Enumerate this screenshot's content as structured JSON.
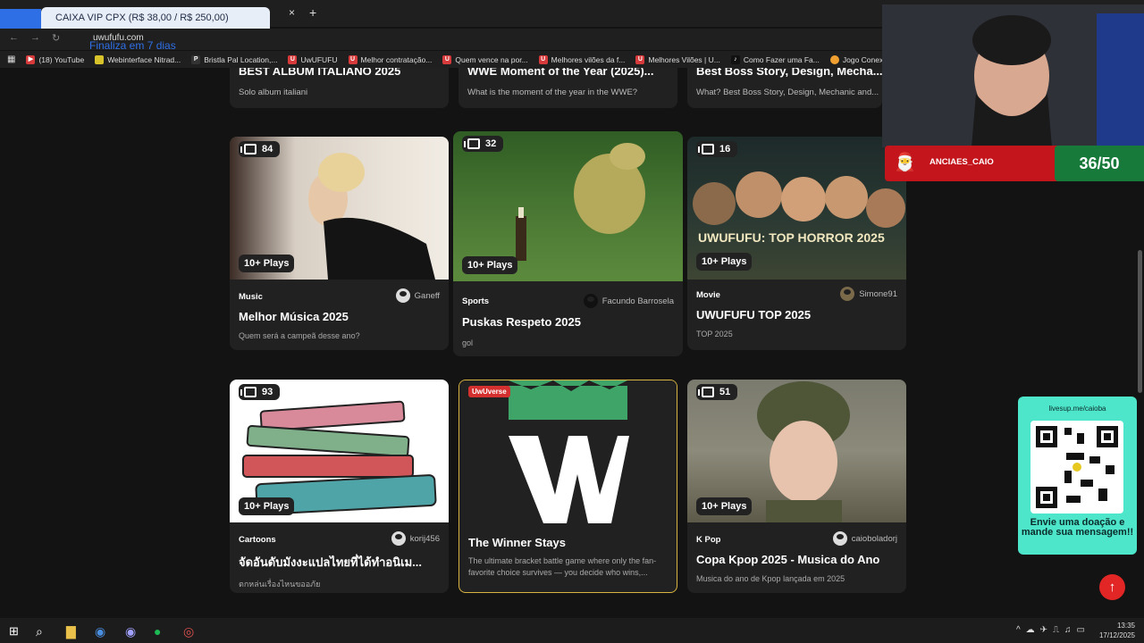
{
  "browser": {
    "tab_title": "CAIXA VIP CPX (R$ 38,00 / R$ 250,00)",
    "tab_close": "×",
    "new_tab": "+",
    "url": "uwufufu.com",
    "overlay_text": "Finaliza em 7 dias",
    "bookmarks": [
      {
        "label": "(18) YouTube"
      },
      {
        "label": "Webinterface Nitrad..."
      },
      {
        "label": "Bristla Pal Location,..."
      },
      {
        "label": "UwUFUFU"
      },
      {
        "label": "Melhor contratação..."
      },
      {
        "label": "Quem vence na por..."
      },
      {
        "label": "Melhores vilões da f..."
      },
      {
        "label": "Melhores Vilões | U..."
      },
      {
        "label": "Como Fazer uma Fa..."
      },
      {
        "label": "Jogo Conexões Esp..."
      }
    ]
  },
  "top_cards": [
    {
      "title": "BEST ALBUM ITALIANO 2025",
      "desc": "Solo album italiani"
    },
    {
      "title": "WWE Moment of the Year (2025)...",
      "desc": "What is the moment of the year in the WWE?"
    },
    {
      "title": "Best Boss Story, Design, Mecha...",
      "desc": "What? Best Boss Story, Design, Mechanic and..."
    }
  ],
  "cards": [
    {
      "count": "84",
      "plays": "10+ Plays",
      "category": "Music",
      "author": "Ganeff",
      "title": "Melhor Música 2025",
      "desc": "Quem será a campeã desse ano?"
    },
    {
      "count": "32",
      "plays": "10+ Plays",
      "category": "Sports",
      "author": "Facundo Barrosela",
      "title": "Puskas Respeto 2025",
      "desc": "gol"
    },
    {
      "count": "16",
      "plays": "10+ Plays",
      "category": "Movie",
      "author": "Simone91",
      "title": "UWUFUFU TOP 2025",
      "desc": "TOP 2025",
      "thumb_text": "UWUFUFU: TOP HORROR 2025"
    },
    {
      "count": "93",
      "plays": "10+ Plays",
      "category": "Cartoons",
      "author": "korij456",
      "title": "จัดอันดับมังงะแปลไทยที่ได้ทำอนิเม...",
      "desc": "ตกหล่นเรื่องไหนขออภัย"
    },
    {
      "badge": "UwUverse",
      "title": "The Winner Stays",
      "desc": "The ultimate bracket battle game where only the fan-favorite choice survives — you decide who wins,..."
    },
    {
      "count": "51",
      "plays": "10+ Plays",
      "category": "K Pop",
      "author": "caioboladorj",
      "title": "Copa Kpop 2025 - Musica do Ano",
      "desc": "Musica do ano de Kpop lançada em 2025"
    }
  ],
  "stream": {
    "handle": "ANCIAES_CAIO",
    "score": "36/50",
    "donate_site": "livesup.me/caioba",
    "donate_msg": "Envie uma doação e mande sua mensagem!!"
  },
  "taskbar": {
    "time": "13:35",
    "date": "17/12/2025"
  },
  "colors": {
    "background": "#131313",
    "card": "#212121",
    "accent_red": "#e22626",
    "qr_panel": "#4ee6cb",
    "uwuverse_border": "#d9b441"
  }
}
